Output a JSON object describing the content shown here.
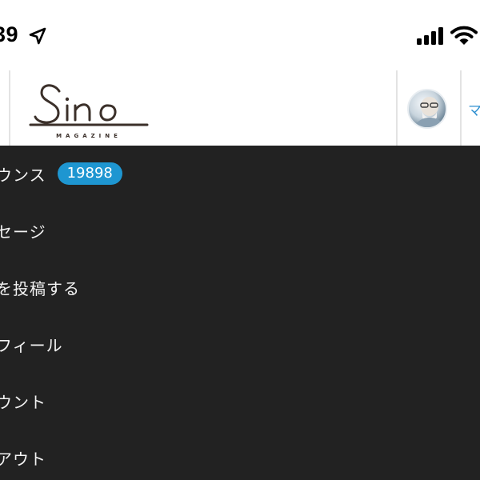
{
  "status_bar": {
    "time": "39",
    "icons": [
      "location-arrow-icon",
      "cellular-signal-icon",
      "wifi-icon"
    ]
  },
  "header": {
    "logo_text": "Sino",
    "logo_subtext": "MAGAZINE",
    "avatar": "user-avatar",
    "cut_label": "マ",
    "colors": {
      "logo": "#3b302a",
      "link": "#2d8fd0"
    }
  },
  "menu": {
    "colors": {
      "background": "#222222",
      "text": "#f2f2f2",
      "badge": "#1e96d1"
    },
    "items": [
      {
        "label": "ウンス",
        "badge": "19898"
      },
      {
        "label": "セージ"
      },
      {
        "label": "を投稿する"
      },
      {
        "label": "フィール"
      },
      {
        "label": "ウント"
      },
      {
        "label": "アウト"
      }
    ]
  }
}
